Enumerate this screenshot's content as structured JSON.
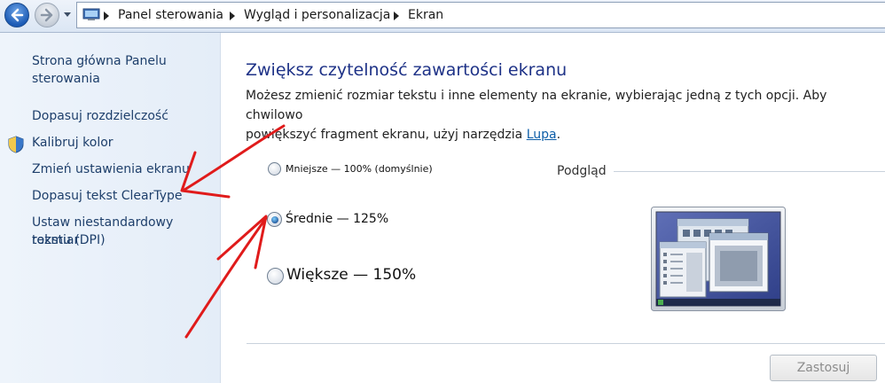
{
  "breadcrumb": {
    "items": [
      "Panel sterowania",
      "Wygląd i personalizacja",
      "Ekran"
    ]
  },
  "icons": {
    "back": "back-arrow-icon",
    "forward": "forward-arrow-icon",
    "address": "control-panel-icon",
    "shield": "uac-shield-icon"
  },
  "sidebar": {
    "items": [
      {
        "label": "Strona główna Panelu"
      },
      {
        "label": "sterowania"
      },
      {
        "label": "Dopasuj rozdzielczość"
      },
      {
        "label": "Kalibruj kolor"
      },
      {
        "label": "Zmień ustawienia ekranu"
      },
      {
        "label": "Dopasuj tekst ClearType"
      },
      {
        "label": "Ustaw niestandardowy rozmiar"
      },
      {
        "label": "tekstu (DPI)"
      }
    ]
  },
  "main": {
    "title": "Zwiększ czytelność zawartości ekranu",
    "desc_line1": "Możesz zmienić rozmiar tekstu i inne elementy na ekranie, wybierając jedną z tych opcji. Aby chwilowo",
    "desc_line2": "powiększyć fragment ekranu, użyj narzędzia ",
    "desc_link": "Lupa",
    "desc_end": ".",
    "options": [
      {
        "label": "Mniejsze — 100% (domyślnie)",
        "checked": false
      },
      {
        "label": "Średnie — 125%",
        "checked": true
      },
      {
        "label": "Większe — 150%",
        "checked": false
      }
    ],
    "preview_label": "Podgląd",
    "apply_label": "Zastosuj"
  },
  "colors": {
    "title": "#1e3287",
    "link": "#0e5ea8",
    "sidebar_link": "#1e3f6b",
    "annotation_arrow": "#e01b1b"
  }
}
